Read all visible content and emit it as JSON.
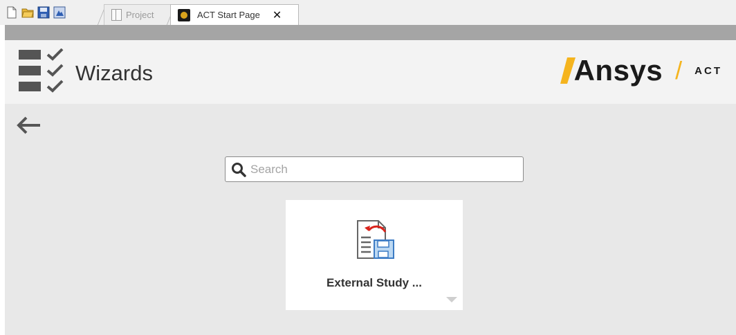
{
  "toolbar": {
    "buttons": [
      "new-icon",
      "open-icon",
      "save-icon",
      "save-as-icon"
    ]
  },
  "tabs": {
    "project_label": "Project",
    "act_label": "ACT Start Page",
    "close_glyph": "✕"
  },
  "header": {
    "title": "Wizards",
    "brand": "Ansys",
    "brand_separator": "/",
    "product": "ACT",
    "accent_color": "#f5b41e"
  },
  "search": {
    "placeholder": "Search",
    "value": ""
  },
  "wizards": [
    {
      "label": "External Study ...",
      "icon": "external-study-icon"
    }
  ]
}
